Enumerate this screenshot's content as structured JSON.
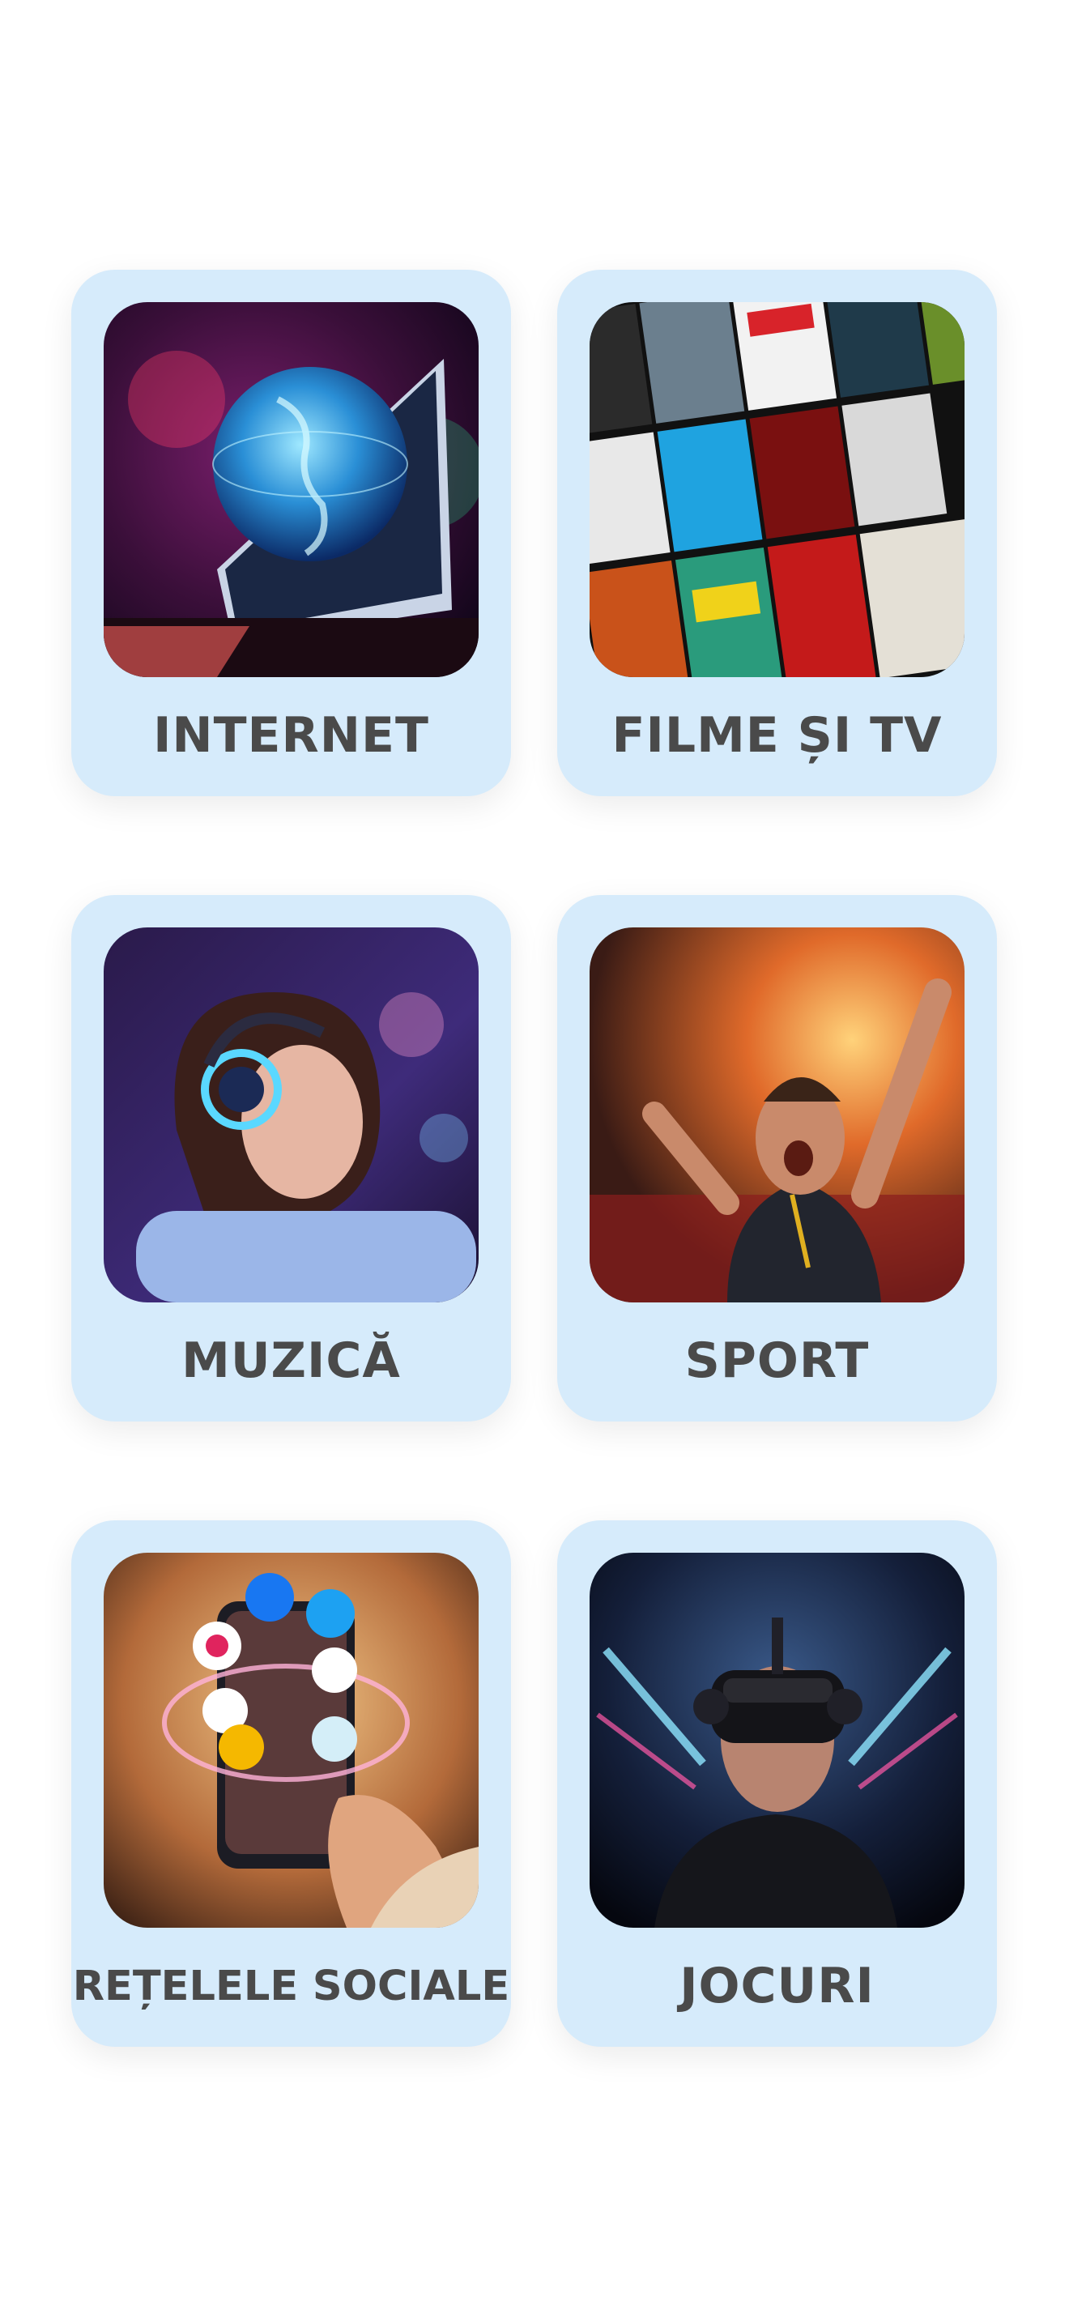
{
  "categories": [
    {
      "label": "INTERNET",
      "icon": "globe-monitor-icon"
    },
    {
      "label": "FILME ȘI TV",
      "icon": "movie-posters-icon"
    },
    {
      "label": "MUZICĂ",
      "icon": "headphones-icon"
    },
    {
      "label": "SPORT",
      "icon": "sports-fan-icon"
    },
    {
      "label": "REȚELELE SOCIALE",
      "icon": "social-phone-icon"
    },
    {
      "label": "JOCURI",
      "icon": "vr-headset-icon"
    }
  ],
  "colors": {
    "card_background": "#d6ebfb",
    "label_text": "#4a4a4a",
    "page_background": "#ffffff"
  }
}
